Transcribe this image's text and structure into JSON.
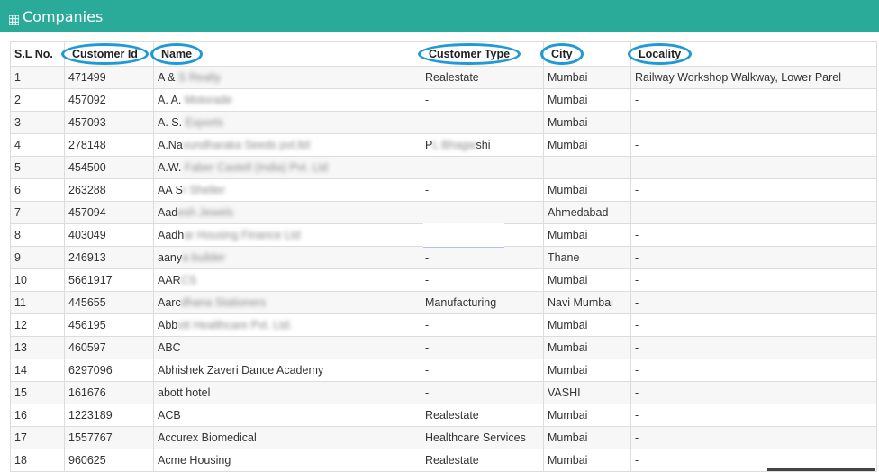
{
  "panel": {
    "title": "Companies",
    "icon": "table-grid-icon",
    "header_color": "#2aab99"
  },
  "table": {
    "headers": [
      "S.L No.",
      "Customer Id",
      "Name",
      "Customer Type",
      "City",
      "Locality"
    ],
    "rows": [
      [
        "1",
        "471499",
        "A & S Realty",
        "Realestate",
        "Mumbai",
        "Railway Workshop Walkway, Lower Parel"
      ],
      [
        "2",
        "457092",
        "A. A. Motorade",
        "-",
        "Mumbai",
        "-"
      ],
      [
        "3",
        "457093",
        "A. S. Exports",
        "-",
        "Mumbai",
        "-"
      ],
      [
        "4",
        "278148",
        "A.Navundharaka Seeds pvt.ltd",
        "PL Bhagwshi",
        "Mumbai",
        "-"
      ],
      [
        "5",
        "454500",
        "A.W. Faber Castell (India) Pvt. Ltd",
        "-",
        "-",
        "-"
      ],
      [
        "6",
        "263288",
        "AA Sr Shelter",
        "-",
        "Mumbai",
        "-"
      ],
      [
        "7",
        "457094",
        "Aadesh Jewels",
        "-",
        "Ahmedabad",
        "-"
      ],
      [
        "8",
        "403049",
        "Aadhar Housing Finance Ltd",
        "-",
        "Mumbai",
        "-"
      ],
      [
        "9",
        "246913",
        "aanya builder",
        "-",
        "Thane",
        "-"
      ],
      [
        "10",
        "5661917",
        "AARCS",
        "-",
        "Mumbai",
        "-"
      ],
      [
        "11",
        "445655",
        "Aaradhana Stationers",
        "Manufacturing",
        "Navi Mumbai",
        "-"
      ],
      [
        "12",
        "456195",
        "Abbott Healthcare Pvt. Ltd.",
        "-",
        "Mumbai",
        "-"
      ],
      [
        "13",
        "460597",
        "ABC",
        "-",
        "Mumbai",
        "-"
      ],
      [
        "14",
        "6297096",
        "Abhishek Zaveri Dance Academy",
        "-",
        "Mumbai",
        "-"
      ],
      [
        "15",
        "161676",
        "abott hotel",
        "-",
        "VASHI",
        "-"
      ],
      [
        "16",
        "1223189",
        "ACB",
        "Realestate",
        "Mumbai",
        "-"
      ],
      [
        "17",
        "1557767",
        "Accurex Biomedical",
        "Healthcare Services",
        "Mumbai",
        "-"
      ],
      [
        "18",
        "960625",
        "Acme Housing",
        "Realestate",
        "Mumbai",
        "-"
      ]
    ]
  },
  "annotation_color": "#1e9ad6"
}
